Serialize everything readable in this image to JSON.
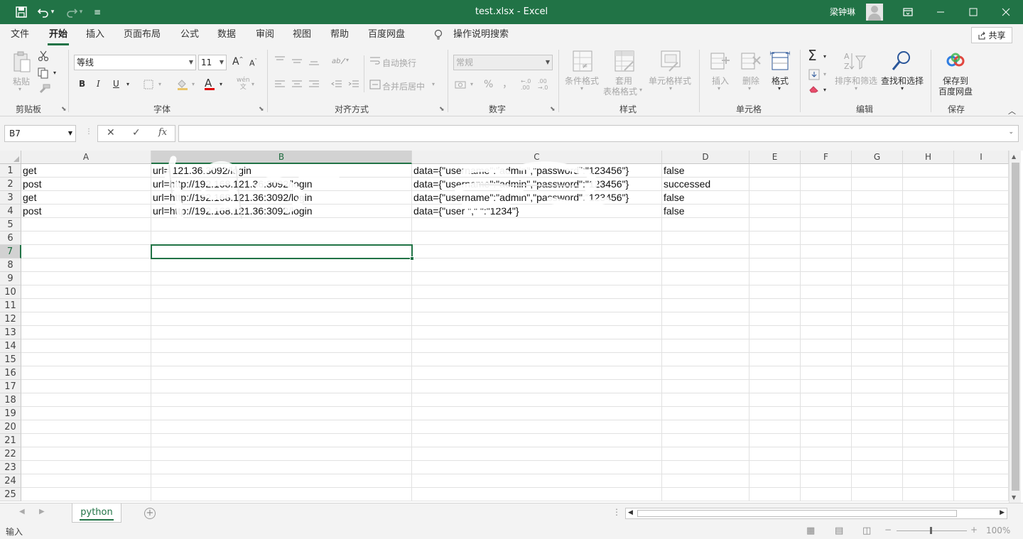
{
  "titlebar": {
    "title": "test.xlsx  -  Excel",
    "user": "梁钟琳",
    "save_icon": "💾",
    "undo_icon": "↶",
    "redo_icon": "↷",
    "customize_icon": "⌄",
    "ribbon_display_icon": "▭",
    "minimize_icon": "─",
    "restore_icon": "☐",
    "close_icon": "✕"
  },
  "menu": {
    "tabs": [
      "文件",
      "开始",
      "插入",
      "页面布局",
      "公式",
      "数据",
      "审阅",
      "视图",
      "帮助",
      "百度网盘"
    ],
    "active": "开始",
    "tellme": "操作说明搜索",
    "share": "共享"
  },
  "ribbon": {
    "clipboard": {
      "label": "剪贴板",
      "paste": "粘贴"
    },
    "font": {
      "label": "字体",
      "font_name": "等线",
      "font_size": "11",
      "bold": "B",
      "italic": "I",
      "underline": "U",
      "grow": "A",
      "shrink": "A",
      "color_letter": "A",
      "phonetic": "wén",
      "phonetic2": "文"
    },
    "alignment": {
      "label": "对齐方式",
      "wrap": "自动换行",
      "merge": "合并后居中"
    },
    "number": {
      "label": "数字",
      "format": "常规",
      "percent": "%",
      "comma": "，",
      "inc_decimal": "←.0 .00",
      "dec_decimal": ".00 →.0"
    },
    "styles": {
      "label": "样式",
      "conditional": "条件格式",
      "table_line1": "套用",
      "table_line2": "表格格式",
      "cell_styles": "单元格样式"
    },
    "cells": {
      "label": "单元格",
      "insert": "插入",
      "delete": "删除",
      "format": "格式"
    },
    "editing": {
      "label": "编辑",
      "sum": "Σ",
      "sort": "排序和筛选",
      "find": "查找和选择"
    },
    "save": {
      "label": "保存",
      "line1": "保存到",
      "line2": "百度网盘"
    }
  },
  "formula_bar": {
    "name_box": "B7",
    "cancel": "✕",
    "enter": "✓",
    "fx": "fx",
    "formula": ""
  },
  "sheet": {
    "columns": [
      "A",
      "B",
      "C",
      "D",
      "E",
      "F",
      "G",
      "H",
      "I"
    ],
    "selected_column": "B",
    "selected_row": 7,
    "rows": [
      "1",
      "2",
      "3",
      "4",
      "5",
      "6",
      "7",
      "8",
      "9",
      "10",
      "11",
      "12",
      "13",
      "14",
      "15",
      "16",
      "17",
      "18",
      "19",
      "20",
      "21",
      "22",
      "23",
      "24",
      "25"
    ],
    "data": [
      [
        "get",
        "url=            121.36.3092/login",
        "data={\"username\":\"admin\",\"password\":\"123456\"}",
        "false"
      ],
      [
        "post",
        "url=http://192.168.121.36:3092/login",
        "data={\"username\":\"admin\",\"password\":\"123456\"}",
        "successed"
      ],
      [
        "get",
        "url=http://192.168.121.36:3092/login",
        "data={\"username\":\"admin\",\"password\":\"123456\"}",
        "false"
      ],
      [
        "post",
        "url=http://192.168.121.36:3092/login",
        "data={\"user                \",\"                \":\"1234\"}",
        "false"
      ]
    ]
  },
  "tabs_bar": {
    "sheet_name": "python",
    "add": "+",
    "prev": "◀",
    "next": "▶"
  },
  "status": {
    "mode": "输入",
    "zoom": "100%",
    "minus": "−",
    "plus": "+"
  }
}
